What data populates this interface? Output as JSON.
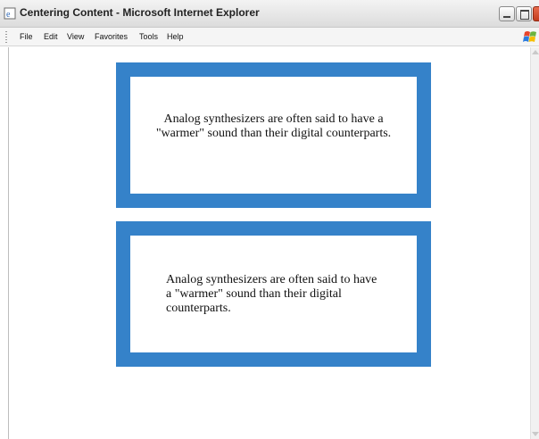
{
  "window": {
    "title": "Centering Content - Microsoft Internet Explorer"
  },
  "menu": {
    "items": [
      "File",
      "Edit",
      "View",
      "Favorites",
      "Tools",
      "Help"
    ]
  },
  "content": {
    "box1_text": "Analog synthesizers are often said to have a \"warmer\" sound than their digital counterparts.",
    "box2_text": "Analog synthesizers are often said to have a \"warmer\" sound than their digital counterparts."
  },
  "colors": {
    "box_border": "#3582c9"
  },
  "icons": [
    "ie-page-icon",
    "minimize-icon",
    "maximize-icon",
    "close-icon",
    "windows-logo-icon",
    "scroll-up-arrow-icon",
    "scroll-down-arrow-icon"
  ]
}
